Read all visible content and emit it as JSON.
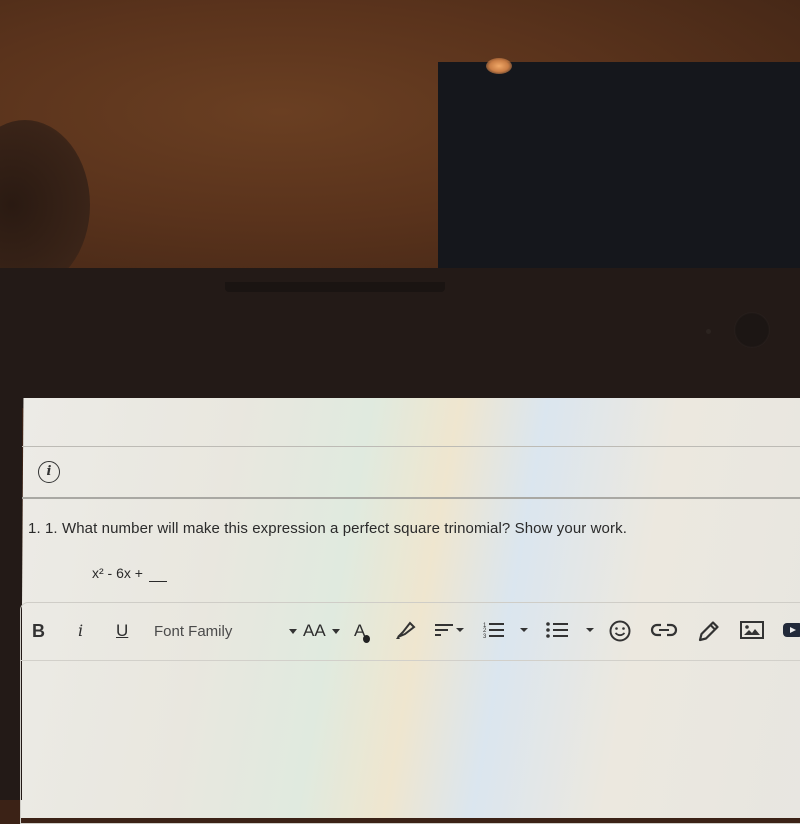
{
  "question": {
    "number": "1. 1.",
    "text": "What number will make this expression a perfect square trinomial?  Show your work.",
    "expression": "x² - 6x +"
  },
  "info_icon": "i",
  "toolbar": {
    "bold": "B",
    "italic": "i",
    "underline": "U",
    "font_family": "Font Family",
    "font_size": "AA",
    "font_color": "A",
    "icons": [
      "highlighter-icon",
      "align-icon",
      "numbered-list-icon",
      "bullet-list-icon",
      "emoji-icon",
      "link-icon",
      "pencil-icon",
      "image-icon",
      "video-icon"
    ]
  },
  "editor": {
    "content": ""
  }
}
